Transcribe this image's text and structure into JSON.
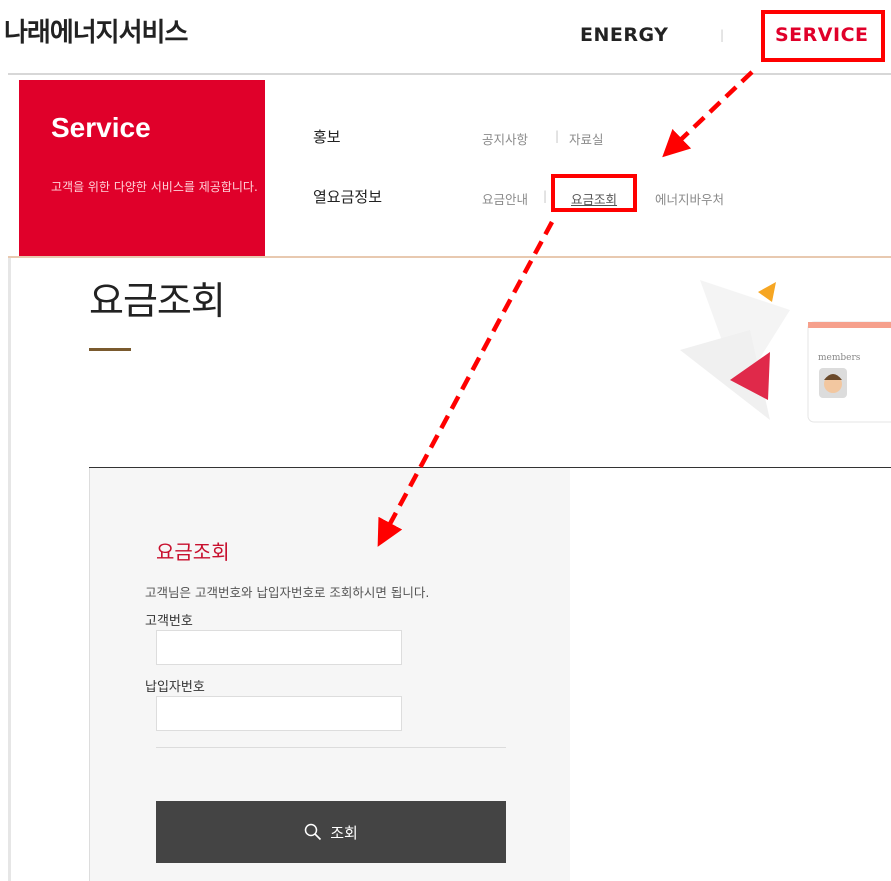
{
  "header": {
    "logo": "나래에너지서비스",
    "nav_energy": "ENERGY",
    "nav_separator": "|",
    "nav_service": "SERVICE"
  },
  "menu": {
    "panel_title": "Service",
    "panel_desc": "고객을 위한 다양한 서비스를 제공합니다.",
    "categories": [
      {
        "label": "홍보",
        "items": [
          "공지사항",
          "자료실"
        ]
      },
      {
        "label": "열요금정보",
        "items": [
          "요금안내",
          "요금조회",
          "에너지바우처"
        ]
      }
    ],
    "divider": "|"
  },
  "page": {
    "title": "요금조회",
    "illustration_label": "members"
  },
  "form": {
    "title": "요금조회",
    "description": "고객님은 고객번호와 납입자번호로 조회하시면 됩니다.",
    "customer_number_label": "고객번호",
    "customer_number_value": "",
    "payer_number_label": "납입자번호",
    "payer_number_value": "",
    "submit_label": "조회"
  },
  "colors": {
    "brand_red": "#e0002a",
    "annotation_red": "#ff0000",
    "button_dark": "#444444",
    "title_accent": "#7a5a2e"
  }
}
